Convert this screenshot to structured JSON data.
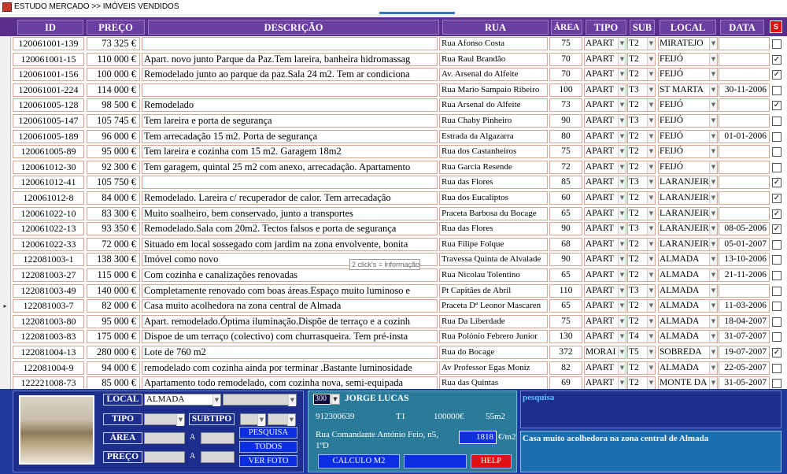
{
  "window": {
    "title": "ESTUDO MERCADO >> IMÓVEIS VENDIDOS"
  },
  "headers": {
    "id": "ID",
    "preco": "PREÇO",
    "descricao": "DESCRIÇÃO",
    "rua": "RUA",
    "area": "ÁREA",
    "tipo": "TIPO",
    "sub": "SUB",
    "local": "LOCAL",
    "data": "DATA",
    "s": "S"
  },
  "rows": [
    {
      "id": "120061001-139",
      "preco": "73 325 €",
      "desc": "",
      "rua": "Rua Afonso Costa",
      "area": "75",
      "tipo": "APART",
      "sub": "T2",
      "local": "MIRATEJO",
      "data": "",
      "chk": ""
    },
    {
      "id": "120061001-15",
      "preco": "110 000 €",
      "desc": "Apart. novo junto Parque da Paz.Tem lareira, banheira hidromassag",
      "rua": "Rua Raul Brandão",
      "area": "70",
      "tipo": "APART",
      "sub": "T2",
      "local": "FEIJÓ",
      "data": "",
      "chk": "✓"
    },
    {
      "id": "120061001-156",
      "preco": "100 000 €",
      "desc": "Remodelado junto ao parque da paz.Sala 24 m2. Tem ar condiciona",
      "rua": "Av. Arsenal do Alfeite",
      "area": "70",
      "tipo": "APART",
      "sub": "T2",
      "local": "FEIJÓ",
      "data": "",
      "chk": "✓"
    },
    {
      "id": "120061001-224",
      "preco": "114 000 €",
      "desc": "",
      "rua": "Rua Mario Sampaio Ribeiro",
      "area": "100",
      "tipo": "APART",
      "sub": "T3",
      "local": "ST MARTA",
      "data": "30-11-2006",
      "chk": ""
    },
    {
      "id": "120061005-128",
      "preco": "98 500 €",
      "desc": "Remodelado",
      "rua": "Rua Arsenal do Alfeite",
      "area": "73",
      "tipo": "APART",
      "sub": "T2",
      "local": "FEIJÓ",
      "data": "",
      "chk": "✓"
    },
    {
      "id": "120061005-147",
      "preco": "105 745 €",
      "desc": "Tem lareira e porta de segurança",
      "rua": "Rua Chaby Pinheiro",
      "area": "90",
      "tipo": "APART",
      "sub": "T3",
      "local": "FEIJÓ",
      "data": "",
      "chk": ""
    },
    {
      "id": "120061005-189",
      "preco": "96 000 €",
      "desc": "Tem arrecadação 15 m2. Porta de segurança",
      "rua": "Estrada da Algazarra",
      "area": "80",
      "tipo": "APART",
      "sub": "T2",
      "local": "FEIJÓ",
      "data": "01-01-2006",
      "chk": ""
    },
    {
      "id": "120061005-89",
      "preco": "95 000 €",
      "desc": "Tem lareira e cozinha com 15 m2. Garagem 18m2",
      "rua": "Rua dos Castanheiros",
      "area": "75",
      "tipo": "APART",
      "sub": "T2",
      "local": "FEIJÓ",
      "data": "",
      "chk": ""
    },
    {
      "id": "120061012-30",
      "preco": "92 300 €",
      "desc": "Tem garagem, quintal 25 m2 com anexo, arrecadação. Apartamento",
      "rua": "Rua Garcia Resende",
      "area": "72",
      "tipo": "APART",
      "sub": "T2",
      "local": "FEIJÓ",
      "data": "",
      "chk": ""
    },
    {
      "id": "120061012-41",
      "preco": "105 750 €",
      "desc": "",
      "rua": "Rua das Flores",
      "area": "85",
      "tipo": "APART",
      "sub": "T3",
      "local": "LARANJEIR",
      "data": "",
      "chk": "✓"
    },
    {
      "id": "120061012-8",
      "preco": "84 000 €",
      "desc": "Remodelado. Lareira c/ recuperador de calor. Tem arrecadação",
      "rua": "Rua dos Eucaliptos",
      "area": "60",
      "tipo": "APART",
      "sub": "T2",
      "local": "LARANJEIR",
      "data": "",
      "chk": "✓"
    },
    {
      "id": "120061022-10",
      "preco": "83 300 €",
      "desc": "Muito soalheiro, bem conservado, junto a transportes",
      "rua": "Praceta Barbosa du Bocage",
      "area": "65",
      "tipo": "APART",
      "sub": "T2",
      "local": "LARANJEIR",
      "data": "",
      "chk": "✓"
    },
    {
      "id": "120061022-13",
      "preco": "93 350 €",
      "desc": "Remodelado.Sala com 20m2. Tectos falsos e porta de segurança",
      "rua": "Rua das Flores",
      "area": "90",
      "tipo": "APART",
      "sub": "T3",
      "local": "LARANJEIR",
      "data": "08-05-2006",
      "chk": "✓"
    },
    {
      "id": "120061022-33",
      "preco": "72 000 €",
      "desc": "Situado em local sossegado com jardim na zona envolvente, bonita",
      "rua": "Rua Filipe Folque",
      "area": "68",
      "tipo": "APART",
      "sub": "T2",
      "local": "LARANJEIR",
      "data": "05-01-2007",
      "chk": ""
    },
    {
      "id": "122081003-1",
      "preco": "138 300 €",
      "desc": "Imóvel como novo",
      "rua": "Travessa Quinta de Alvalade",
      "area": "90",
      "tipo": "APART",
      "sub": "T2",
      "local": "ALMADA",
      "data": "13-10-2006",
      "chk": ""
    },
    {
      "id": "122081003-27",
      "preco": "115 000 €",
      "desc": "Com cozinha e canalizações renovadas",
      "rua": "Rua Nicolau Tolentino",
      "area": "65",
      "tipo": "APART",
      "sub": "T2",
      "local": "ALMADA",
      "data": "21-11-2006",
      "chk": ""
    },
    {
      "id": "122081003-49",
      "preco": "140 000 €",
      "desc": "Completamente renovado com boas áreas.Espaço muito luminoso e",
      "rua": "Pt Capitães de Abril",
      "area": "110",
      "tipo": "APART",
      "sub": "T3",
      "local": "ALMADA",
      "data": "",
      "chk": ""
    },
    {
      "id": "122081003-7",
      "preco": "82 000 €",
      "desc": "Casa muito acolhedora na zona central de Almada",
      "rua": "Praceta Dª Leonor Mascaren",
      "area": "65",
      "tipo": "APART",
      "sub": "T2",
      "local": "ALMADA",
      "data": "11-03-2006",
      "chk": ""
    },
    {
      "id": "122081003-80",
      "preco": "95 000 €",
      "desc": "Apart. remodelado.Óptima iluminação.Dispõe de terraço e a cozinh",
      "rua": "Rua Da Liberdade",
      "area": "75",
      "tipo": "APART",
      "sub": "T2",
      "local": "ALMADA",
      "data": "18-04-2007",
      "chk": ""
    },
    {
      "id": "122081003-83",
      "preco": "175 000 €",
      "desc": "Dispoe de um terraço (colectivo) com churrasqueira. Tem pré-insta",
      "rua": "Rua Polónio Febrero Junior",
      "area": "130",
      "tipo": "APART",
      "sub": "T4",
      "local": "ALMADA",
      "data": "31-07-2007",
      "chk": ""
    },
    {
      "id": "122081004-13",
      "preco": "280 000 €",
      "desc": "Lote de 760 m2",
      "rua": "Rua do Bocage",
      "area": "372",
      "tipo": "MORAI",
      "sub": "T5",
      "local": "SOBREDA",
      "data": "19-07-2007",
      "chk": "✓"
    },
    {
      "id": "122081004-9",
      "preco": "94 000 €",
      "desc": "remodelado com cozinha ainda por terminar .Bastante luminosidade",
      "rua": "Av Professor Egas Moniz",
      "area": "82",
      "tipo": "APART",
      "sub": "T2",
      "local": "ALMADA",
      "data": "22-05-2007",
      "chk": ""
    },
    {
      "id": "122221008-73",
      "preco": "85 000 €",
      "desc": "Apartamento todo remodelado, com cozinha nova, semi-equipada",
      "rua": "Rua das Quintas",
      "area": "69",
      "tipo": "APART",
      "sub": "T2",
      "local": "MONTE DA",
      "data": "31-05-2007",
      "chk": ""
    }
  ],
  "tooltip": "2 click's = informação",
  "search": {
    "local_label": "LOCAL",
    "local_value": "ALMADA",
    "local_value2": "",
    "tipo_label": "TIPO",
    "subtipo_label": "SUBTIPO",
    "area_label": "ÁREA",
    "preco_label": "PREÇO",
    "a": "A",
    "btn_pesquisa": "PESQUISA",
    "btn_todos": "TODOS",
    "btn_foto": "VER FOTO"
  },
  "detail": {
    "num": "300",
    "name": "JORGE LUCAS",
    "phone": "912300639",
    "type": "T1",
    "price": "100000€",
    "area": "55m2",
    "address": "Rua Comandante António Feio, n5, 1ºD",
    "calc_value": "1818",
    "calc_unit": "€/m2",
    "btn_calc": "CALCULO M2",
    "btn_blank": "",
    "btn_help": "HELP"
  },
  "pesquisa_panel": {
    "label": "pesquisa"
  },
  "desc_panel": {
    "text": "Casa muito acolhedora na zona central de Almada"
  }
}
